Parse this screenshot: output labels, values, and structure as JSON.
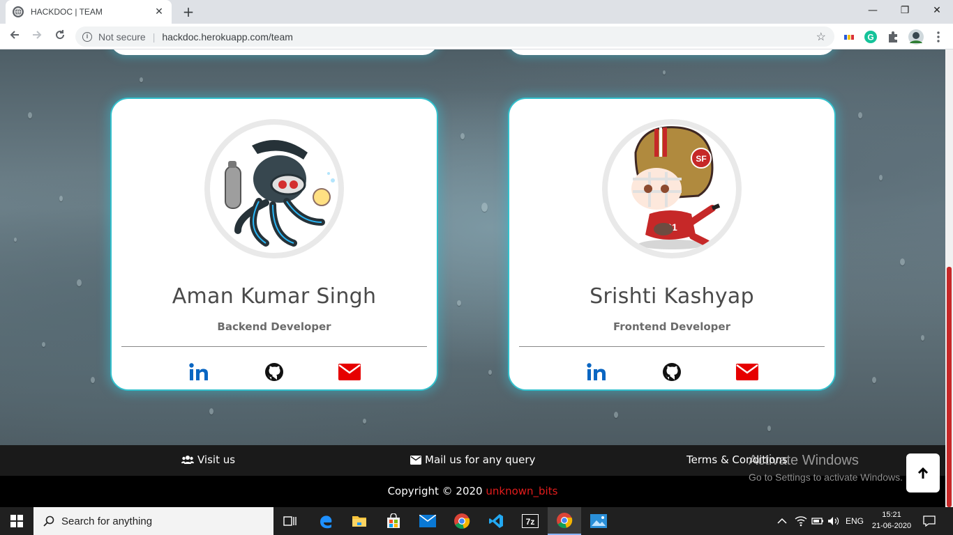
{
  "browser": {
    "tab_title": "HACKDOC | TEAM",
    "tab_close": "✕",
    "new_tab": "+",
    "not_secure": "Not secure",
    "url": "hackdoc.herokuapp.com/team",
    "window_controls": {
      "minimize": "—",
      "restore": "❐",
      "close": "✕"
    }
  },
  "team": [
    {
      "name": "Aman Kumar Singh",
      "role": "Backend Developer",
      "avatar_icon": "scuba-octocat-avatar",
      "links": [
        "linkedin-icon",
        "github-icon",
        "mail-icon"
      ]
    },
    {
      "name": "Srishti Kashyap",
      "role": "Frontend Developer",
      "avatar_icon": "football-octocat-avatar",
      "links": [
        "linkedin-icon",
        "github-icon",
        "mail-icon"
      ]
    }
  ],
  "footer": {
    "visit": "Visit us",
    "mail": "Mail us for any query",
    "terms": "Terms & Conditions",
    "copyright": "Copyright © 2020",
    "brand": "unknown_bits"
  },
  "overlay": {
    "activate_title": "Activate Windows",
    "activate_sub": "Go to Settings to activate Windows."
  },
  "taskbar": {
    "search_placeholder": "Search for anything",
    "language": "ENG",
    "time": "15:21",
    "date": "21-06-2020"
  },
  "colors": {
    "card_border": "#33c0cc",
    "linkedin": "#0a66c2",
    "mail": "#e60000",
    "brand_red": "#e41c1c"
  }
}
